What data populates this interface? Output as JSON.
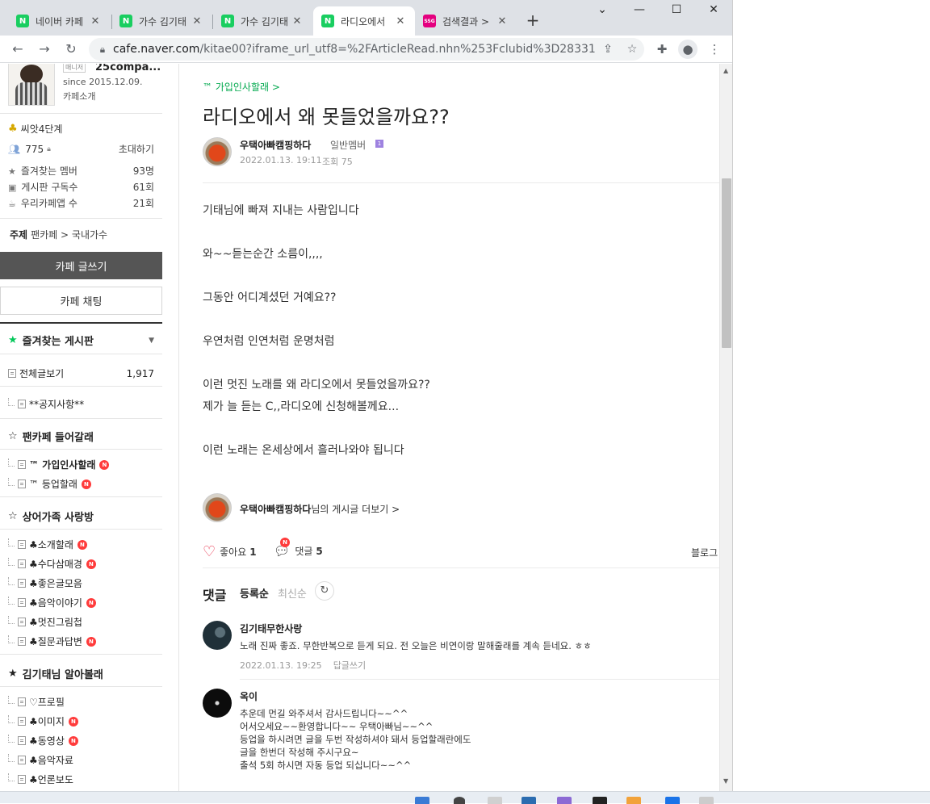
{
  "browser": {
    "tabs": [
      {
        "title": "네이버 카페",
        "favicon": "naver-cafe-icon",
        "active": false
      },
      {
        "title": "가수 김기태",
        "favicon": "naver-cafe-icon",
        "active": false
      },
      {
        "title": "가수 김기태",
        "favicon": "naver-cafe-icon",
        "active": false
      },
      {
        "title": "라디오에서",
        "favicon": "naver-cafe-icon",
        "active": true
      },
      {
        "title": "검색결과 >",
        "favicon": "ssg-icon",
        "active": false
      }
    ],
    "favicon_text": {
      "naver": "N",
      "ssg": "SSG"
    },
    "new_tab": "+",
    "window_controls": {
      "dropdown": "⌄",
      "minimize": "—",
      "maximize": "☐",
      "close": "✕"
    },
    "url_host": "cafe.naver.com",
    "url_path": "/kitae00?iframe_url_utf8=%2FArticleRead.nhn%253Fclubid%3D28331975%2..."
  },
  "sidebar": {
    "manager_badge": "매니저",
    "manager_name": "25compa...",
    "since": "since 2015.12.09.",
    "cafe_intro": "카페소개",
    "level": "씨앗4단계",
    "member_count": "775",
    "invite": "초대하기",
    "stats": [
      {
        "label": "즐겨찾는 멤버",
        "value": "93명",
        "icon": "star-icon"
      },
      {
        "label": "게시판 구독수",
        "value": "61회",
        "icon": "rss-icon"
      },
      {
        "label": "우리카페앱 수",
        "value": "21회",
        "icon": "app-icon"
      }
    ],
    "topic_label": "주제",
    "topic_value": "팬카페 > 국내가수",
    "write_button": "카페 글쓰기",
    "chat_button": "카페 채팅",
    "favorites_title": "즐겨찾는 게시판",
    "all_posts": "전체글보기",
    "all_posts_count": "1,917",
    "notice": "**공지사항**",
    "section1_title": "팬카페 들어갈래",
    "section1_items": [
      "™ 가입인사할래",
      "™ 등업할래"
    ],
    "section2_title": "상어가족 사랑방",
    "section2_items": [
      "♣소개할래",
      "♣수다삼매경",
      "♣좋은글모음",
      "♣음악이야기",
      "♣멋진그림첩",
      "♣질문과답변"
    ],
    "section3_title": "김기태님 알아볼래",
    "section3_items": [
      "♡프로필",
      "♣이미지",
      "♣동영상",
      "♣음악자료",
      "♣언론보도"
    ],
    "new_badge": "N"
  },
  "article": {
    "board": "™ 가입인사할래 >",
    "title": "라디오에서 왜 못들었을까요??",
    "author": "우택아빠캠핑하다",
    "grade": "일반멤버",
    "grade_badge": "1",
    "date": "2022.01.13. 19:11",
    "views": "조회 75",
    "body": [
      "기태님에 빠져 지내는 사람입니다",
      "와~~듣는순간 소름이,,,,",
      "그동안 어디계셨던 거예요??",
      "우연처럼 인연처럼 운명처럼",
      "이런 멋진 노래를 왜 라디오에서 못들었을까요??",
      "제가 늘 듣는 C,,라디오에 신청해볼께요...",
      "이런 노래는 온세상에서 흘러나와야 됩니다"
    ],
    "more_author": "우택아빠캠핑하다",
    "more_suffix": "님의 게시글 더보기 >",
    "like_label": "좋아요",
    "like_count": "1",
    "comment_label": "댓글",
    "comment_count": "5",
    "blog_label": "블로그"
  },
  "comments": {
    "header": "댓글",
    "sort_registered": "등록순",
    "sort_latest": "최신순",
    "items": [
      {
        "author": "김기태무한사랑",
        "lines": [
          "노래 진짜 좋죠. 무한반복으로 듣게 되요. 전 오늘은 비연이랑 말해줄래를 계속 듣네요. ㅎㅎ"
        ],
        "date": "2022.01.13. 19:25",
        "reply": "답글쓰기"
      },
      {
        "author": "옥이",
        "lines": [
          "추운데 먼길 와주셔서 감사드립니다~~^^",
          "어서오세요~~환영합니다~~ 우택아빠님~~^^",
          "등업을 하시려면 글을 두번 작성하셔야 돼서 등업할래란에도",
          "글을 한번더 작성해 주시구요~",
          "출석 5회 하시면 자동 등업 되십니다~~^^"
        ]
      }
    ]
  },
  "colors": {
    "accent": "#03a94f",
    "new_badge": "#ff3b3b",
    "heart": "#e8344e",
    "write_button": "#555555"
  }
}
